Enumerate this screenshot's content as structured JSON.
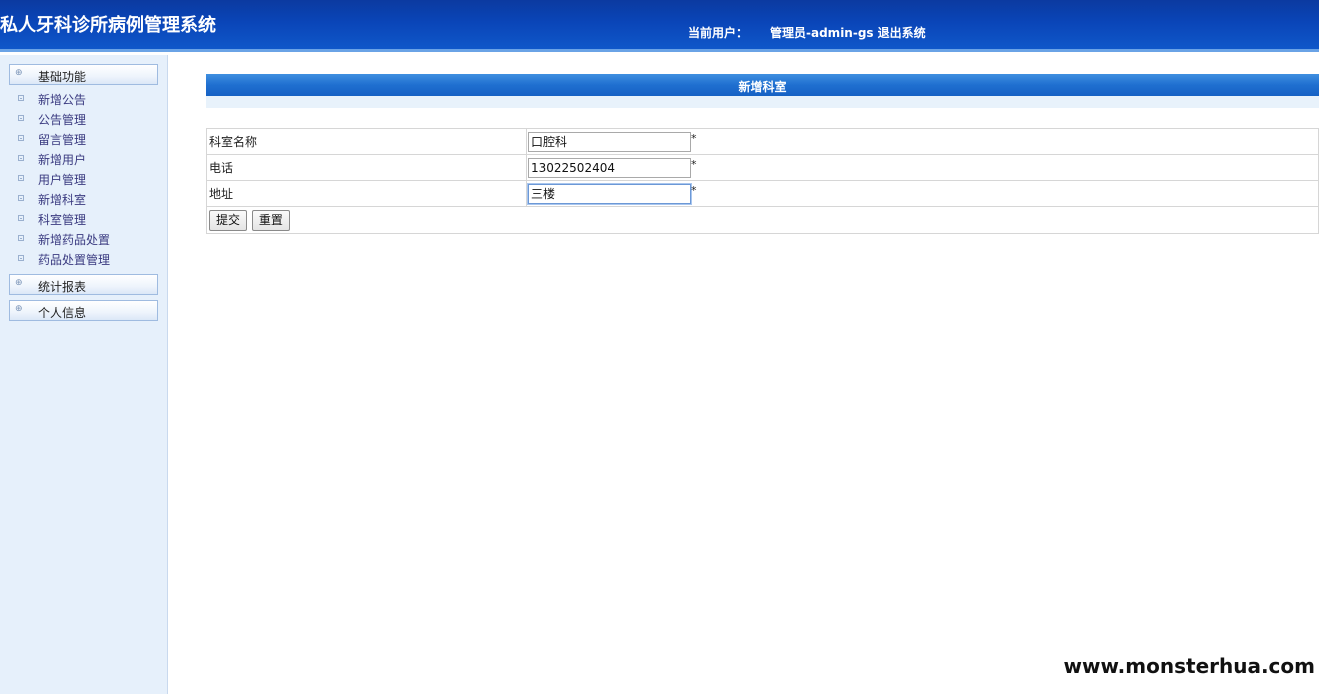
{
  "header": {
    "title": "私人牙科诊所病例管理系统",
    "user_label": "当前用户：",
    "user_name": "管理员-admin-gs",
    "logout": "退出系统"
  },
  "sidebar": {
    "groups": [
      {
        "label": "基础功能",
        "items": [
          "新增公告",
          "公告管理",
          "留言管理",
          "新增用户",
          "用户管理",
          "新增科室",
          "科室管理",
          "新增药品处置",
          "药品处置管理"
        ]
      },
      {
        "label": "统计报表"
      },
      {
        "label": "个人信息"
      }
    ]
  },
  "main": {
    "panel_title": "新增科室",
    "fields": [
      {
        "label": "科室名称",
        "value": "口腔科",
        "required": "*"
      },
      {
        "label": "电话",
        "value": "13022502404",
        "required": "*"
      },
      {
        "label": "地址",
        "value": "三楼",
        "required": "*"
      }
    ],
    "submit_label": "提交",
    "reset_label": "重置"
  },
  "watermark": "www.monsterhua.com",
  "colors": {
    "header_blue": "#0a45b8",
    "panel_bar_blue": "#1f6fd0",
    "sidebar_bg": "#e6f0fb"
  }
}
